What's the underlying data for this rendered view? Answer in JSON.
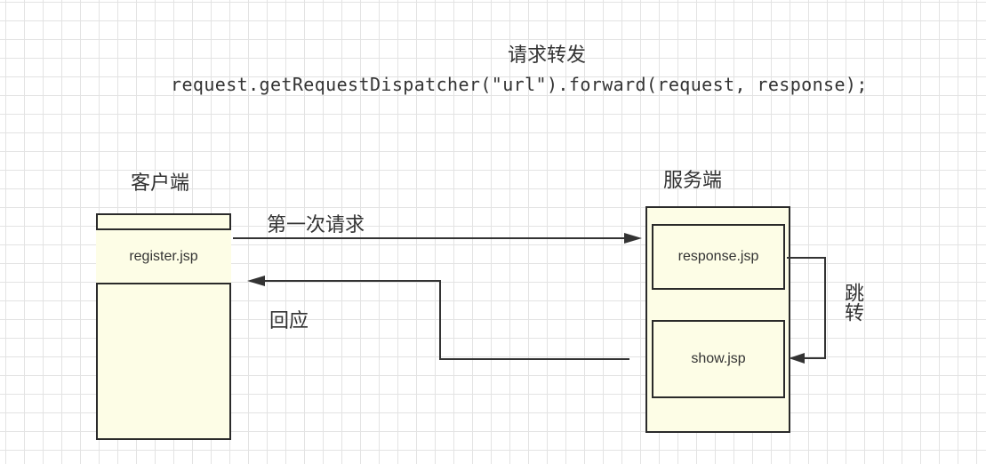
{
  "header": {
    "title": "请求转发",
    "code": "request.getRequestDispatcher(\"url\").forward(request, response);"
  },
  "client": {
    "label": "客户端",
    "file": "register.jsp"
  },
  "server": {
    "label": "服务端",
    "file_top": "response.jsp",
    "file_bottom": "show.jsp"
  },
  "arrows": {
    "request_label": "第一次请求",
    "response_label": "回应",
    "jump_label": "跳转"
  }
}
